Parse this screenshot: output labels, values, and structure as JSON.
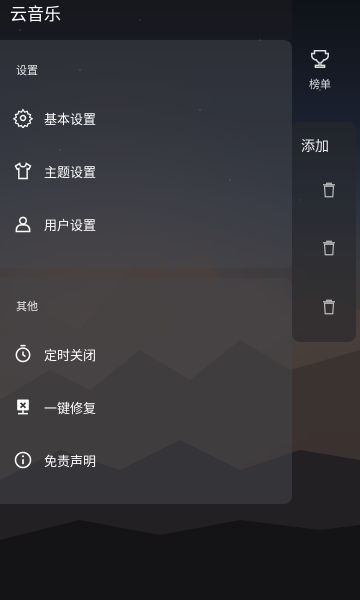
{
  "app": {
    "title": "云音乐"
  },
  "drawer": {
    "section_settings": {
      "title": "设置",
      "items": [
        {
          "label": "基本设置",
          "icon": "gear-icon"
        },
        {
          "label": "主题设置",
          "icon": "tshirt-icon"
        },
        {
          "label": "用户设置",
          "icon": "user-icon"
        }
      ]
    },
    "section_other": {
      "title": "其他",
      "items": [
        {
          "label": "定时关闭",
          "icon": "timer-icon"
        },
        {
          "label": "一键修复",
          "icon": "repair-icon"
        },
        {
          "label": "免责声明",
          "icon": "info-icon"
        }
      ]
    }
  },
  "right_panel": {
    "rank_label": "榜单",
    "add_label": "添加"
  },
  "colors": {
    "drawer_section_bg": "#46464a",
    "topbar_bg": "#1e1e22"
  }
}
